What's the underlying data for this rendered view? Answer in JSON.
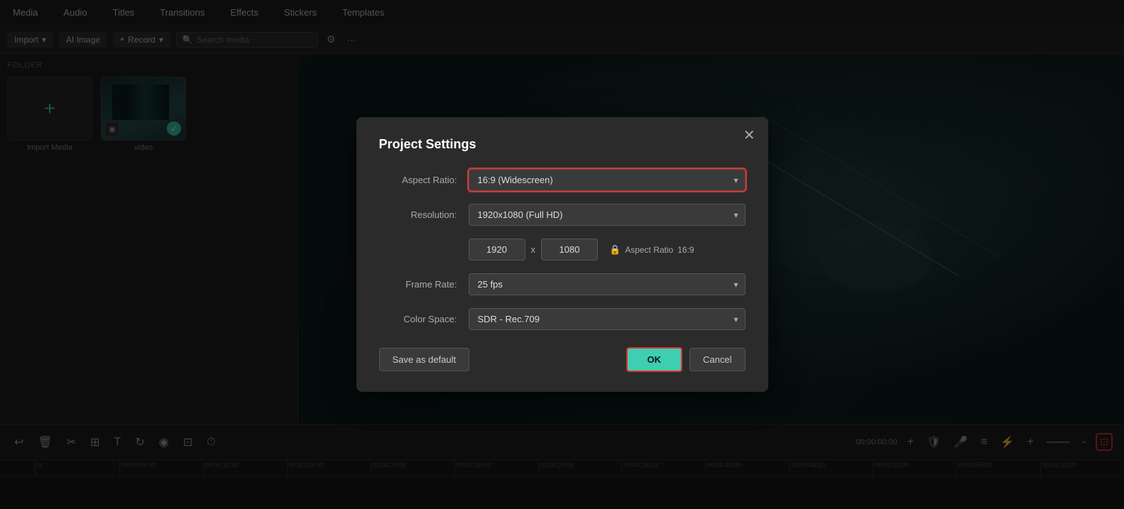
{
  "menuBar": {
    "items": [
      "Media",
      "Audio",
      "Titles",
      "Transitions",
      "Effects",
      "Stickers",
      "Templates"
    ]
  },
  "toolbar": {
    "importLabel": "Import",
    "aiImageLabel": "AI Image",
    "recordLabel": "Record",
    "searchPlaceholder": "Search media"
  },
  "leftPanel": {
    "folderLabel": "FOLDER",
    "importMediaLabel": "Import Media",
    "mediaItems": [
      {
        "name": "video",
        "hasCheck": true
      }
    ]
  },
  "modal": {
    "title": "Project Settings",
    "fields": {
      "aspectRatio": {
        "label": "Aspect Ratio:",
        "value": "16:9 (Widescreen)"
      },
      "resolution": {
        "label": "Resolution:",
        "value": "1920x1080 (Full HD)",
        "width": "1920",
        "height": "1080",
        "lockLabel": "Aspect Ratio",
        "lockValue": "16:9"
      },
      "frameRate": {
        "label": "Frame Rate:",
        "value": "25 fps"
      },
      "colorSpace": {
        "label": "Color Space:",
        "value": "SDR - Rec.709"
      }
    },
    "buttons": {
      "saveDefault": "Save as default",
      "ok": "OK",
      "cancel": "Cancel"
    }
  },
  "timeline": {
    "currentTime": "00:00:00:00",
    "rulerMarks": [
      "0",
      "00:00:05:00",
      "00:00:10:00",
      "00:00:15:00",
      "00:00:20:00",
      "00:00:25:00",
      "00:00:30:00",
      "00:00:35:00",
      "00:00:40:00",
      "00:00:45:00",
      "00:00:50:00",
      "00:00:55:00",
      "00:01:00:00"
    ]
  }
}
